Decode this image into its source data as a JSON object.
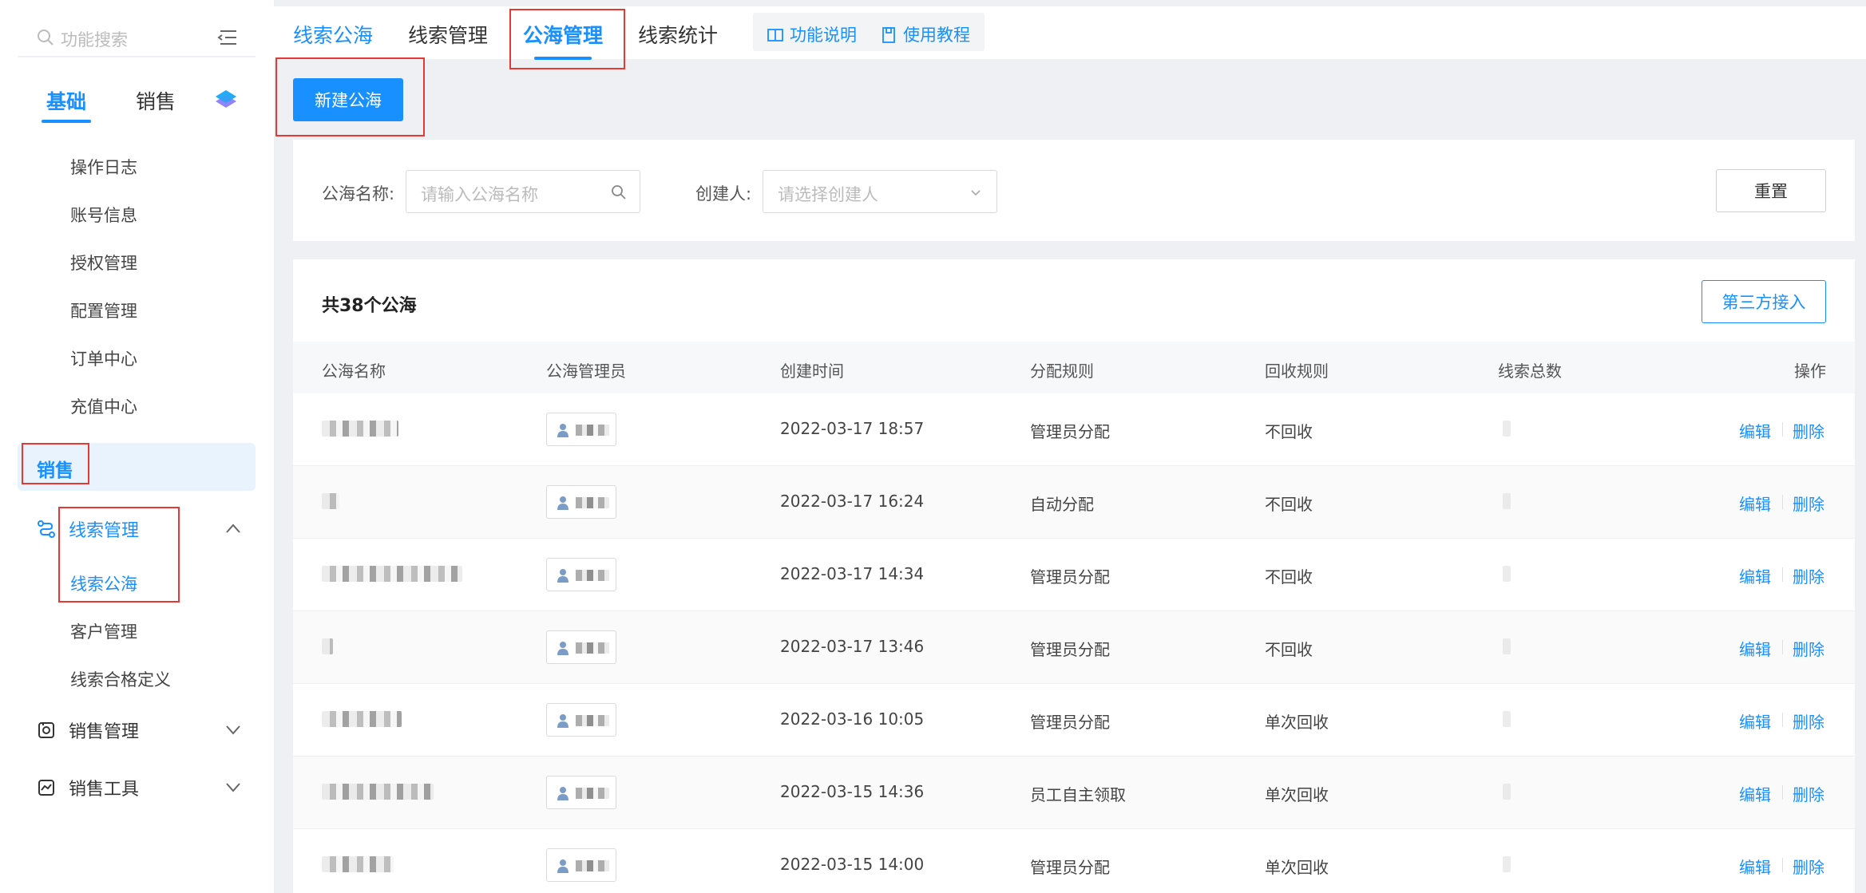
{
  "sidebar": {
    "search_placeholder": "功能搜索",
    "categories": [
      {
        "label": "基础",
        "active": true
      },
      {
        "label": "销售",
        "active": false
      }
    ],
    "basic_items": [
      "操作日志",
      "账号信息",
      "授权管理",
      "配置管理",
      "订单中心",
      "充值中心"
    ],
    "section_label": "销售",
    "groups": [
      {
        "label": "线索管理",
        "open": true,
        "children": [
          {
            "label": "线索公海",
            "active": true
          },
          {
            "label": "客户管理",
            "active": false
          },
          {
            "label": "线索合格定义",
            "active": false
          }
        ]
      },
      {
        "label": "销售管理",
        "open": false
      },
      {
        "label": "销售工具",
        "open": false
      }
    ]
  },
  "top_tabs": [
    {
      "label": "线索公海"
    },
    {
      "label": "线索管理"
    },
    {
      "label": "公海管理",
      "active": true
    },
    {
      "label": "线索统计"
    }
  ],
  "help_links": [
    "功能说明",
    "使用教程"
  ],
  "toolbar": {
    "new_button": "新建公海"
  },
  "filters": {
    "name_label": "公海名称:",
    "name_placeholder": "请输入公海名称",
    "creator_label": "创建人:",
    "creator_placeholder": "请选择创建人",
    "reset_button": "重置"
  },
  "table": {
    "total_text": "共38个公海",
    "third_party_button": "第三方接入",
    "columns": [
      "公海名称",
      "公海管理员",
      "创建时间",
      "分配规则",
      "回收规则",
      "线索总数",
      "操作"
    ],
    "rows": [
      {
        "created": "2022-03-17 18:57",
        "assign_rule": "管理员分配",
        "recycle_rule": "不回收"
      },
      {
        "created": "2022-03-17 16:24",
        "assign_rule": "自动分配",
        "recycle_rule": "不回收"
      },
      {
        "created": "2022-03-17 14:34",
        "assign_rule": "管理员分配",
        "recycle_rule": "不回收"
      },
      {
        "created": "2022-03-17 13:46",
        "assign_rule": "管理员分配",
        "recycle_rule": "不回收"
      },
      {
        "created": "2022-03-16 10:05",
        "assign_rule": "管理员分配",
        "recycle_rule": "单次回收"
      },
      {
        "created": "2022-03-15 14:36",
        "assign_rule": "员工自主领取",
        "recycle_rule": "单次回收"
      },
      {
        "created": "2022-03-15 14:00",
        "assign_rule": "管理员分配",
        "recycle_rule": "单次回收"
      }
    ],
    "edit_label": "编辑",
    "delete_label": "删除"
  },
  "colors": {
    "primary": "#1890ff",
    "highlight_box": "#e53935"
  }
}
